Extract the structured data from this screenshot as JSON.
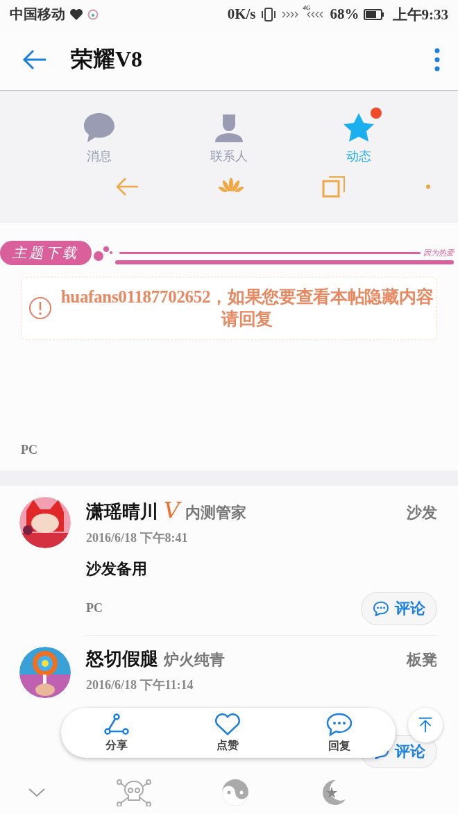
{
  "status_bar": {
    "carrier": "中国移动",
    "speed": "0K/s",
    "network": "4G",
    "battery": "68%",
    "time": "上午9:33"
  },
  "app_bar": {
    "title": "荣耀V8"
  },
  "embedded_screenshot": {
    "tabs": [
      {
        "label": "消息",
        "kind": "chat",
        "selected": false,
        "badge": false
      },
      {
        "label": "联系人",
        "kind": "contact",
        "selected": false,
        "badge": false
      },
      {
        "label": "动态",
        "kind": "star",
        "selected": true,
        "badge": true
      }
    ]
  },
  "banner": {
    "label": "主题下载",
    "tagline": "因为热爱"
  },
  "notice": {
    "text": "huafans01187702652，如果您要查看本帖隐藏内容请回复"
  },
  "source": "PC",
  "posts": [
    {
      "author": "潇瑶晴川",
      "verified_mark": "V",
      "rank": "内测管家",
      "floor": "沙发",
      "time": "2016/6/18 下午8:41",
      "body": "沙发备用",
      "source": "PC",
      "comment": "评论"
    },
    {
      "author": "怒切假腿",
      "rank": "炉火纯青",
      "floor": "板凳",
      "time": "2016/6/18 下午11:14",
      "comment": "评论"
    }
  ],
  "action_bar": [
    {
      "label": "分享",
      "kind": "share"
    },
    {
      "label": "点赞",
      "kind": "like"
    },
    {
      "label": "回复",
      "kind": "reply"
    }
  ]
}
